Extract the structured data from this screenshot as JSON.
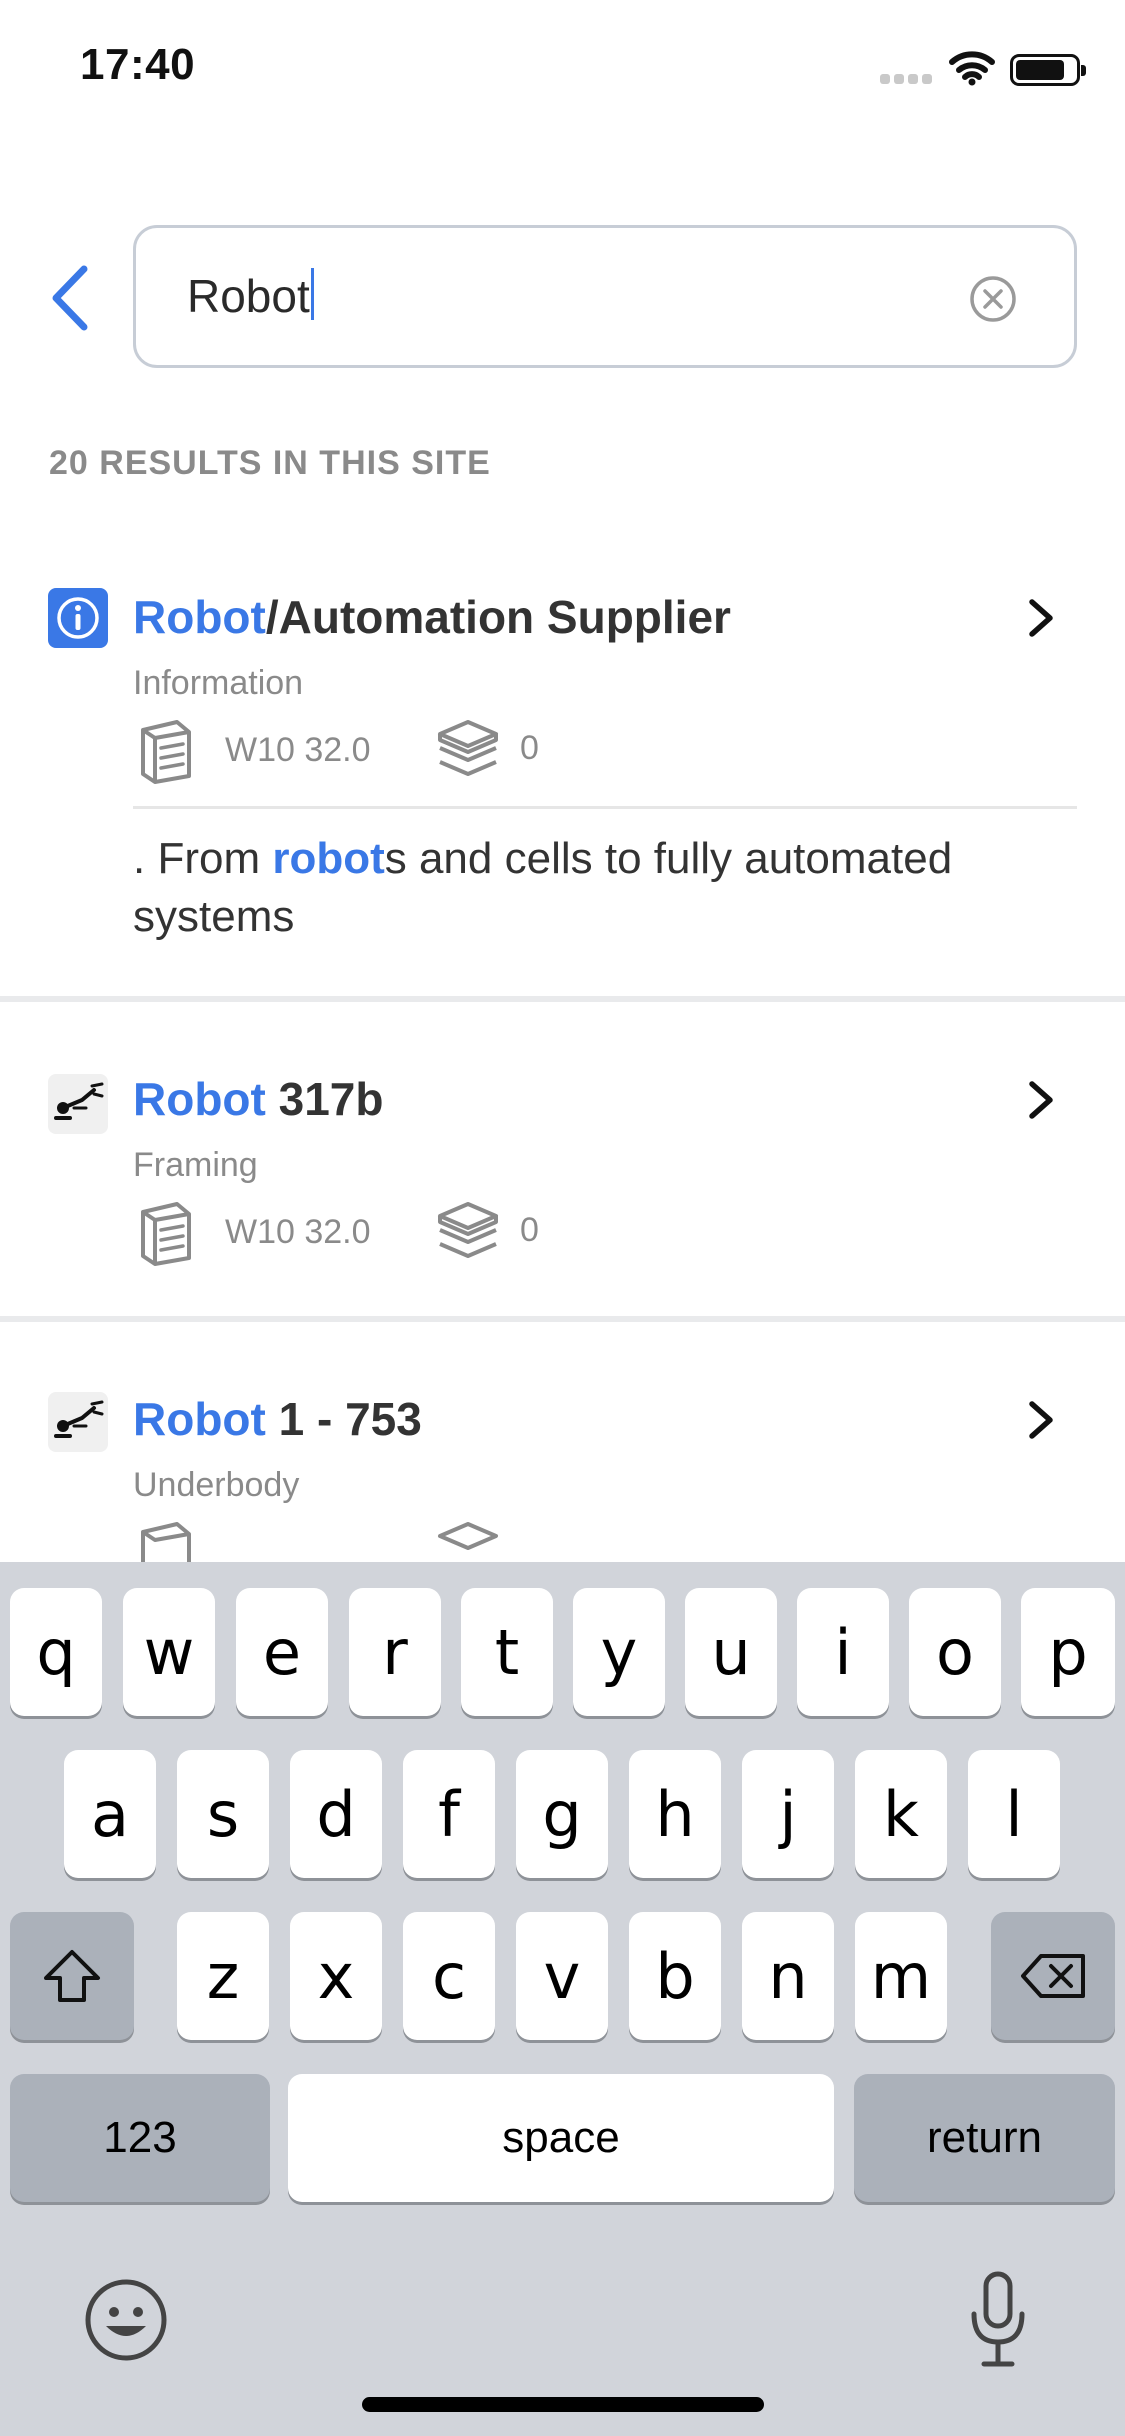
{
  "status_bar": {
    "time": "17:40"
  },
  "search": {
    "query": "Robot"
  },
  "results_header": "20 RESULTS IN THIS SITE",
  "results": [
    {
      "title_highlight": "Robot",
      "title_rest": "/Automation Supplier",
      "category": "Information",
      "file_label": "W10 32.0",
      "layers_count": "0",
      "snippet_pre": ". From ",
      "snippet_highlight": "robot",
      "snippet_post": "s and cells to fully automated systems",
      "icon": "info-icon"
    },
    {
      "title_highlight": "Robot",
      "title_rest": " 317b",
      "category": "Framing",
      "file_label": "W10 32.0",
      "layers_count": "0",
      "icon": "robot-arm-icon"
    },
    {
      "title_highlight": "Robot",
      "title_rest": " 1 - 753",
      "category": "Underbody",
      "icon": "robot-arm-icon"
    }
  ],
  "keyboard": {
    "row1": [
      "q",
      "w",
      "e",
      "r",
      "t",
      "y",
      "u",
      "i",
      "o",
      "p"
    ],
    "row2": [
      "a",
      "s",
      "d",
      "f",
      "g",
      "h",
      "j",
      "k",
      "l"
    ],
    "row3": [
      "z",
      "x",
      "c",
      "v",
      "b",
      "n",
      "m"
    ],
    "numbers_label": "123",
    "space_label": "space",
    "return_label": "return"
  },
  "colors": {
    "accent": "#3a78e6",
    "keyboard_bg": "#d1d4da"
  }
}
